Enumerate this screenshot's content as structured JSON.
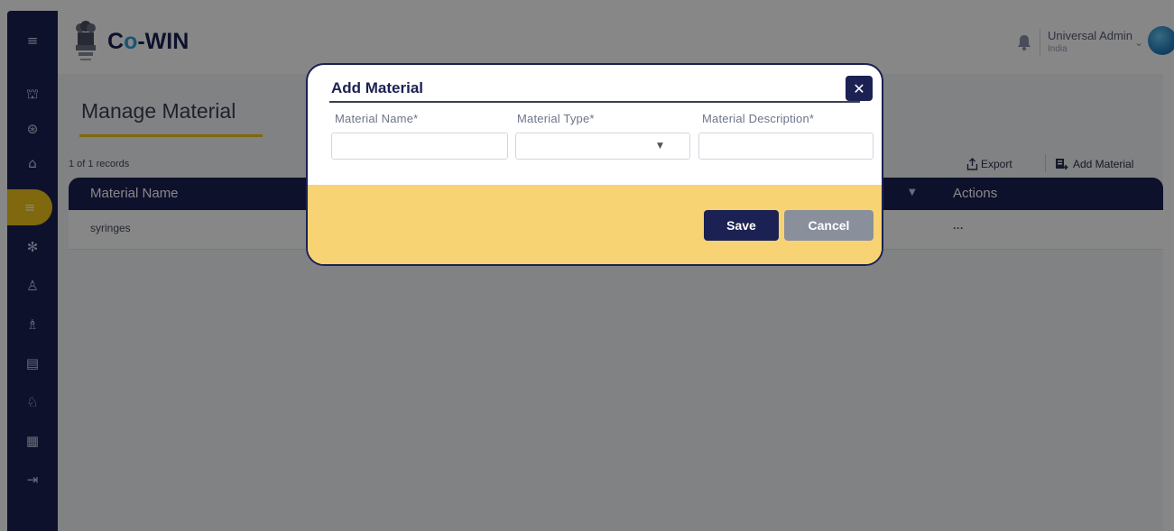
{
  "app": {
    "brand_prefix": "C",
    "brand_o": "o",
    "brand_suffix": "-WIN",
    "user_name": "Universal Admin",
    "user_sub": "India",
    "user_chevron": "⌄"
  },
  "sidebar": {
    "icons": [
      {
        "name": "menu-icon",
        "glyph": "≡"
      },
      {
        "name": "facility-icon",
        "glyph": "⛫"
      },
      {
        "name": "vaccine-icon",
        "glyph": "⊛"
      },
      {
        "name": "building-icon",
        "glyph": "⌂"
      },
      {
        "name": "material-icon",
        "glyph": "≡"
      },
      {
        "name": "virus-icon",
        "glyph": "✻"
      },
      {
        "name": "beneficiary-icon",
        "glyph": "♙"
      },
      {
        "name": "users-icon",
        "glyph": "♗"
      },
      {
        "name": "report-icon",
        "glyph": "▤"
      },
      {
        "name": "lock-user-icon",
        "glyph": "♘"
      },
      {
        "name": "keyboard-icon",
        "glyph": "▦"
      },
      {
        "name": "logout-icon",
        "glyph": "⇥"
      }
    ]
  },
  "page": {
    "title": "Manage Material",
    "records": "1 of 1 records",
    "export_label": "Export",
    "add_label": "Add Material"
  },
  "table": {
    "columns": [
      "Material Name",
      "Actions"
    ],
    "rows": [
      {
        "name": "syringes",
        "actions": "···"
      }
    ]
  },
  "modal": {
    "title": "Add Material",
    "close": "✕",
    "fields": {
      "name_label": "Material Name*",
      "type_label": "Material Type*",
      "desc_label": "Material Description*",
      "name_value": "",
      "type_value": "",
      "desc_value": ""
    },
    "save": "Save",
    "cancel": "Cancel"
  },
  "colors": {
    "navy": "#1b2153",
    "accent_yellow": "#f0c419",
    "footer_yellow": "#f7d373",
    "cancel_gray": "#8a8f9c"
  }
}
